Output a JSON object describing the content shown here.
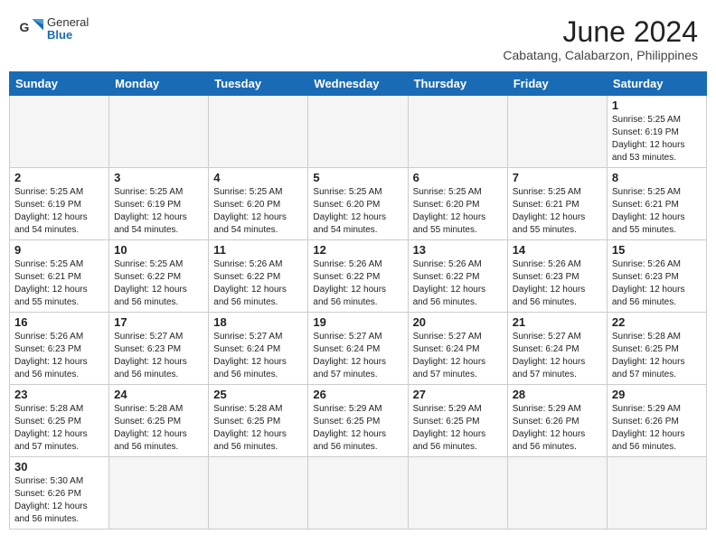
{
  "header": {
    "logo_general": "General",
    "logo_blue": "Blue",
    "month_title": "June 2024",
    "location": "Cabatang, Calabarzon, Philippines"
  },
  "days_of_week": [
    "Sunday",
    "Monday",
    "Tuesday",
    "Wednesday",
    "Thursday",
    "Friday",
    "Saturday"
  ],
  "weeks": [
    [
      {
        "day": "",
        "info": ""
      },
      {
        "day": "",
        "info": ""
      },
      {
        "day": "",
        "info": ""
      },
      {
        "day": "",
        "info": ""
      },
      {
        "day": "",
        "info": ""
      },
      {
        "day": "",
        "info": ""
      },
      {
        "day": "1",
        "info": "Sunrise: 5:25 AM\nSunset: 6:19 PM\nDaylight: 12 hours\nand 53 minutes."
      }
    ],
    [
      {
        "day": "2",
        "info": "Sunrise: 5:25 AM\nSunset: 6:19 PM\nDaylight: 12 hours\nand 54 minutes."
      },
      {
        "day": "3",
        "info": "Sunrise: 5:25 AM\nSunset: 6:19 PM\nDaylight: 12 hours\nand 54 minutes."
      },
      {
        "day": "4",
        "info": "Sunrise: 5:25 AM\nSunset: 6:20 PM\nDaylight: 12 hours\nand 54 minutes."
      },
      {
        "day": "5",
        "info": "Sunrise: 5:25 AM\nSunset: 6:20 PM\nDaylight: 12 hours\nand 54 minutes."
      },
      {
        "day": "6",
        "info": "Sunrise: 5:25 AM\nSunset: 6:20 PM\nDaylight: 12 hours\nand 55 minutes."
      },
      {
        "day": "7",
        "info": "Sunrise: 5:25 AM\nSunset: 6:21 PM\nDaylight: 12 hours\nand 55 minutes."
      },
      {
        "day": "8",
        "info": "Sunrise: 5:25 AM\nSunset: 6:21 PM\nDaylight: 12 hours\nand 55 minutes."
      }
    ],
    [
      {
        "day": "9",
        "info": "Sunrise: 5:25 AM\nSunset: 6:21 PM\nDaylight: 12 hours\nand 55 minutes."
      },
      {
        "day": "10",
        "info": "Sunrise: 5:25 AM\nSunset: 6:22 PM\nDaylight: 12 hours\nand 56 minutes."
      },
      {
        "day": "11",
        "info": "Sunrise: 5:26 AM\nSunset: 6:22 PM\nDaylight: 12 hours\nand 56 minutes."
      },
      {
        "day": "12",
        "info": "Sunrise: 5:26 AM\nSunset: 6:22 PM\nDaylight: 12 hours\nand 56 minutes."
      },
      {
        "day": "13",
        "info": "Sunrise: 5:26 AM\nSunset: 6:22 PM\nDaylight: 12 hours\nand 56 minutes."
      },
      {
        "day": "14",
        "info": "Sunrise: 5:26 AM\nSunset: 6:23 PM\nDaylight: 12 hours\nand 56 minutes."
      },
      {
        "day": "15",
        "info": "Sunrise: 5:26 AM\nSunset: 6:23 PM\nDaylight: 12 hours\nand 56 minutes."
      }
    ],
    [
      {
        "day": "16",
        "info": "Sunrise: 5:26 AM\nSunset: 6:23 PM\nDaylight: 12 hours\nand 56 minutes."
      },
      {
        "day": "17",
        "info": "Sunrise: 5:27 AM\nSunset: 6:23 PM\nDaylight: 12 hours\nand 56 minutes."
      },
      {
        "day": "18",
        "info": "Sunrise: 5:27 AM\nSunset: 6:24 PM\nDaylight: 12 hours\nand 56 minutes."
      },
      {
        "day": "19",
        "info": "Sunrise: 5:27 AM\nSunset: 6:24 PM\nDaylight: 12 hours\nand 57 minutes."
      },
      {
        "day": "20",
        "info": "Sunrise: 5:27 AM\nSunset: 6:24 PM\nDaylight: 12 hours\nand 57 minutes."
      },
      {
        "day": "21",
        "info": "Sunrise: 5:27 AM\nSunset: 6:24 PM\nDaylight: 12 hours\nand 57 minutes."
      },
      {
        "day": "22",
        "info": "Sunrise: 5:28 AM\nSunset: 6:25 PM\nDaylight: 12 hours\nand 57 minutes."
      }
    ],
    [
      {
        "day": "23",
        "info": "Sunrise: 5:28 AM\nSunset: 6:25 PM\nDaylight: 12 hours\nand 57 minutes."
      },
      {
        "day": "24",
        "info": "Sunrise: 5:28 AM\nSunset: 6:25 PM\nDaylight: 12 hours\nand 56 minutes."
      },
      {
        "day": "25",
        "info": "Sunrise: 5:28 AM\nSunset: 6:25 PM\nDaylight: 12 hours\nand 56 minutes."
      },
      {
        "day": "26",
        "info": "Sunrise: 5:29 AM\nSunset: 6:25 PM\nDaylight: 12 hours\nand 56 minutes."
      },
      {
        "day": "27",
        "info": "Sunrise: 5:29 AM\nSunset: 6:25 PM\nDaylight: 12 hours\nand 56 minutes."
      },
      {
        "day": "28",
        "info": "Sunrise: 5:29 AM\nSunset: 6:26 PM\nDaylight: 12 hours\nand 56 minutes."
      },
      {
        "day": "29",
        "info": "Sunrise: 5:29 AM\nSunset: 6:26 PM\nDaylight: 12 hours\nand 56 minutes."
      }
    ],
    [
      {
        "day": "30",
        "info": "Sunrise: 5:30 AM\nSunset: 6:26 PM\nDaylight: 12 hours\nand 56 minutes."
      },
      {
        "day": "",
        "info": ""
      },
      {
        "day": "",
        "info": ""
      },
      {
        "day": "",
        "info": ""
      },
      {
        "day": "",
        "info": ""
      },
      {
        "day": "",
        "info": ""
      },
      {
        "day": "",
        "info": ""
      }
    ]
  ]
}
